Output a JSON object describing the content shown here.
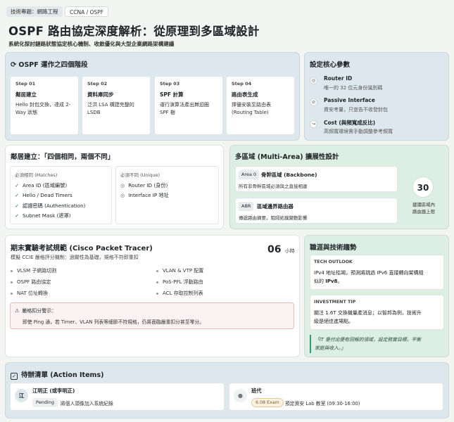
{
  "header": {
    "tag_topic": "技術專題：網路工程",
    "tag_cert": "CCNA / OSPF",
    "title": "OSPF 路由協定深度解析：從原理到多區域設計",
    "subtitle": "系統化探討鏈路狀態協定核心機制、收斂優化與大型企業網路架構建議"
  },
  "phases": {
    "heading": "OSPF 運作之四個階段",
    "steps": [
      {
        "label": "Step 01",
        "name": "鄰居建立",
        "desc": "Hello 封包交換，達成 2-Way 狀態"
      },
      {
        "label": "Step 02",
        "name": "資料庫同步",
        "desc": "泛洪 LSA 構建完整的 LSDB"
      },
      {
        "label": "Step 03",
        "name": "SPF 計算",
        "desc": "運行演算法產出無迴圈 SPF 樹"
      },
      {
        "label": "Step 04",
        "name": "路由表生成",
        "desc": "擇優安裝至路由表 (Routing Table)"
      }
    ]
  },
  "params": {
    "heading": "設定核心參數",
    "items": [
      {
        "icon": "◎",
        "title": "Router ID",
        "desc": "唯一的 32 位元身份識別碼"
      },
      {
        "icon": "⊘",
        "title": "Passive Interface",
        "desc": "資安考量，只宣告不收發封包"
      },
      {
        "icon": "↝",
        "title": "Cost (與頻寬成反比)",
        "desc": "高頻寬環境需手動調整參考頻寬"
      }
    ]
  },
  "neighbor": {
    "heading": "鄰居建立：「四個相同，兩個不同」",
    "same_title": "必須相同 (Matches)",
    "same": [
      "Area ID (區域編號)",
      "Hello / Dead Timers",
      "認證密碼 (Authentication)",
      "Subnet Mask (遮罩)"
    ],
    "diff_title": "必須不同 (Unique)",
    "diff": [
      "Router ID (身份)",
      "Interface IP 地址"
    ]
  },
  "multi": {
    "heading": "多區域 (Multi-Area) 擴展性設計",
    "area0_badge": "Area 0",
    "area0_title": "骨幹區域 (Backbone)",
    "area0_desc": "所有非骨幹區域必須與之直接相連",
    "abr_badge": "ABR",
    "abr_title": "區域邊界路由器",
    "abr_desc": "傳遞路由摘要，阻隔拓撲變動影響",
    "limit_value": "30",
    "limit_label_1": "建議區域內",
    "limit_label_2": "路由器上限"
  },
  "exam": {
    "heading": "期末實驗考試規範 (Cisco Packet Tracer)",
    "subheading": "模擬 CCIE 嚴格評分機制：過關性為基礎，規格不符即重扣",
    "hours_value": "06",
    "hours_unit": "小時",
    "items": [
      "VLSM 子網路切割",
      "VLAN & VTP 配置",
      "OSPF 路由協定",
      "PoS-PFL 浮動路由",
      "NAT 位址轉換",
      "ACL 存取控制列表"
    ],
    "warn_title": "嚴格扣分警示：",
    "warn_text": "即使 Ping 通，若 Timer、VLAN 列表等細節不符規格，仍將面臨嚴重扣分甚至零分。"
  },
  "career": {
    "heading": "職涯與技術趨勢",
    "outlook_title": "TECH OUTLOOK",
    "outlook_text_1": "IPv4 地址枯竭，預測將跳過 IPv6 直接轉向架構相",
    "outlook_text_2": "似的 ",
    "outlook_bold": "IPv8",
    "outlook_text_3": "。",
    "tip_title": "INVESTMENT TIP",
    "tip_text_1": "關注 1.6T 交換機量產消息；以智邦為例，技術升",
    "tip_text_2": "級是絕佳進場點。",
    "quote_1": "「IT 是付出便有回報的領域，設定務實目標，平衡",
    "quote_2": "家庭與收入。」"
  },
  "actions": {
    "heading": "待辦清單 (Action Items)",
    "items": [
      {
        "avatar": "江",
        "name": "江明正 (或李明正)",
        "badge": "Pending",
        "desc": "將個人頭像加入系統紀錄"
      },
      {
        "avatar": "",
        "name": "班代",
        "badge": "6.08 Exam",
        "desc": "預定資安 Lab 教室 (09:30-16:00)"
      }
    ]
  },
  "colors": {
    "bg": "#f3f5f2",
    "blue_panel": "#dde7ee",
    "green_panel": "#ddeee4",
    "accent_green": "#2f9d6b",
    "warn_border": "#e6b8b8"
  }
}
